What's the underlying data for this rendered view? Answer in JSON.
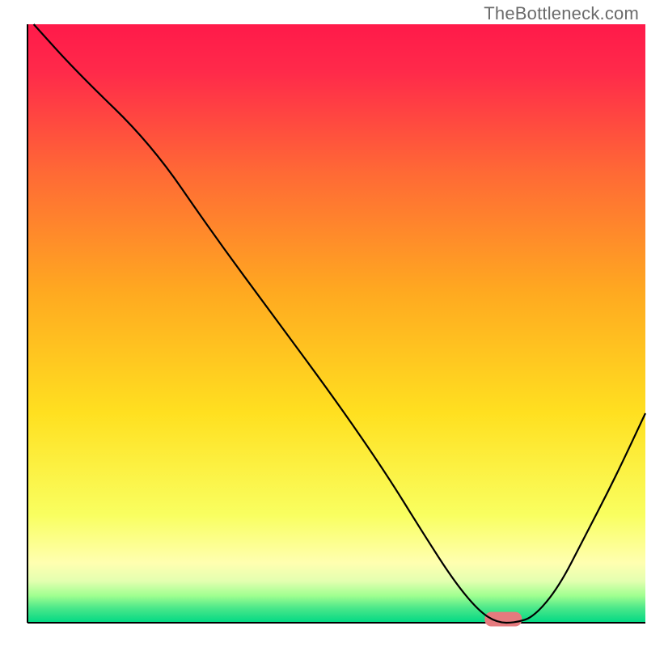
{
  "watermark": "TheBottleneck.com",
  "chart_data": {
    "type": "line",
    "title": "",
    "xlabel": "",
    "ylabel": "",
    "xlim": [
      0,
      100
    ],
    "ylim": [
      0,
      100
    ],
    "background": {
      "type": "vertical_gradient",
      "stops": [
        {
          "pos": 0.0,
          "color": "#ff1a4a"
        },
        {
          "pos": 0.08,
          "color": "#ff2a4a"
        },
        {
          "pos": 0.25,
          "color": "#ff6a35"
        },
        {
          "pos": 0.45,
          "color": "#ffaa20"
        },
        {
          "pos": 0.65,
          "color": "#ffe020"
        },
        {
          "pos": 0.82,
          "color": "#f9ff60"
        },
        {
          "pos": 0.9,
          "color": "#ffffb0"
        },
        {
          "pos": 0.93,
          "color": "#e4ffb0"
        },
        {
          "pos": 0.955,
          "color": "#9fff90"
        },
        {
          "pos": 0.975,
          "color": "#4de88a"
        },
        {
          "pos": 1.0,
          "color": "#00d884"
        }
      ]
    },
    "series": [
      {
        "name": "curve",
        "stroke": "#000000",
        "x": [
          1,
          8,
          20,
          30,
          40,
          50,
          58,
          64,
          69,
          73,
          76,
          79,
          82,
          86,
          90,
          95,
          100
        ],
        "values": [
          100,
          92,
          80,
          65,
          51,
          37,
          25,
          15,
          7,
          2,
          0,
          0,
          1,
          6,
          14,
          24,
          35
        ]
      }
    ],
    "marker": {
      "shape": "rounded_rect",
      "x_center": 77,
      "y_center": 0.6,
      "width": 6,
      "height": 2.4,
      "color": "#e67a7e"
    },
    "axes": {
      "left": {
        "stroke": "#000000",
        "width": 2
      },
      "bottom": {
        "stroke": "#000000",
        "width": 2
      }
    }
  }
}
